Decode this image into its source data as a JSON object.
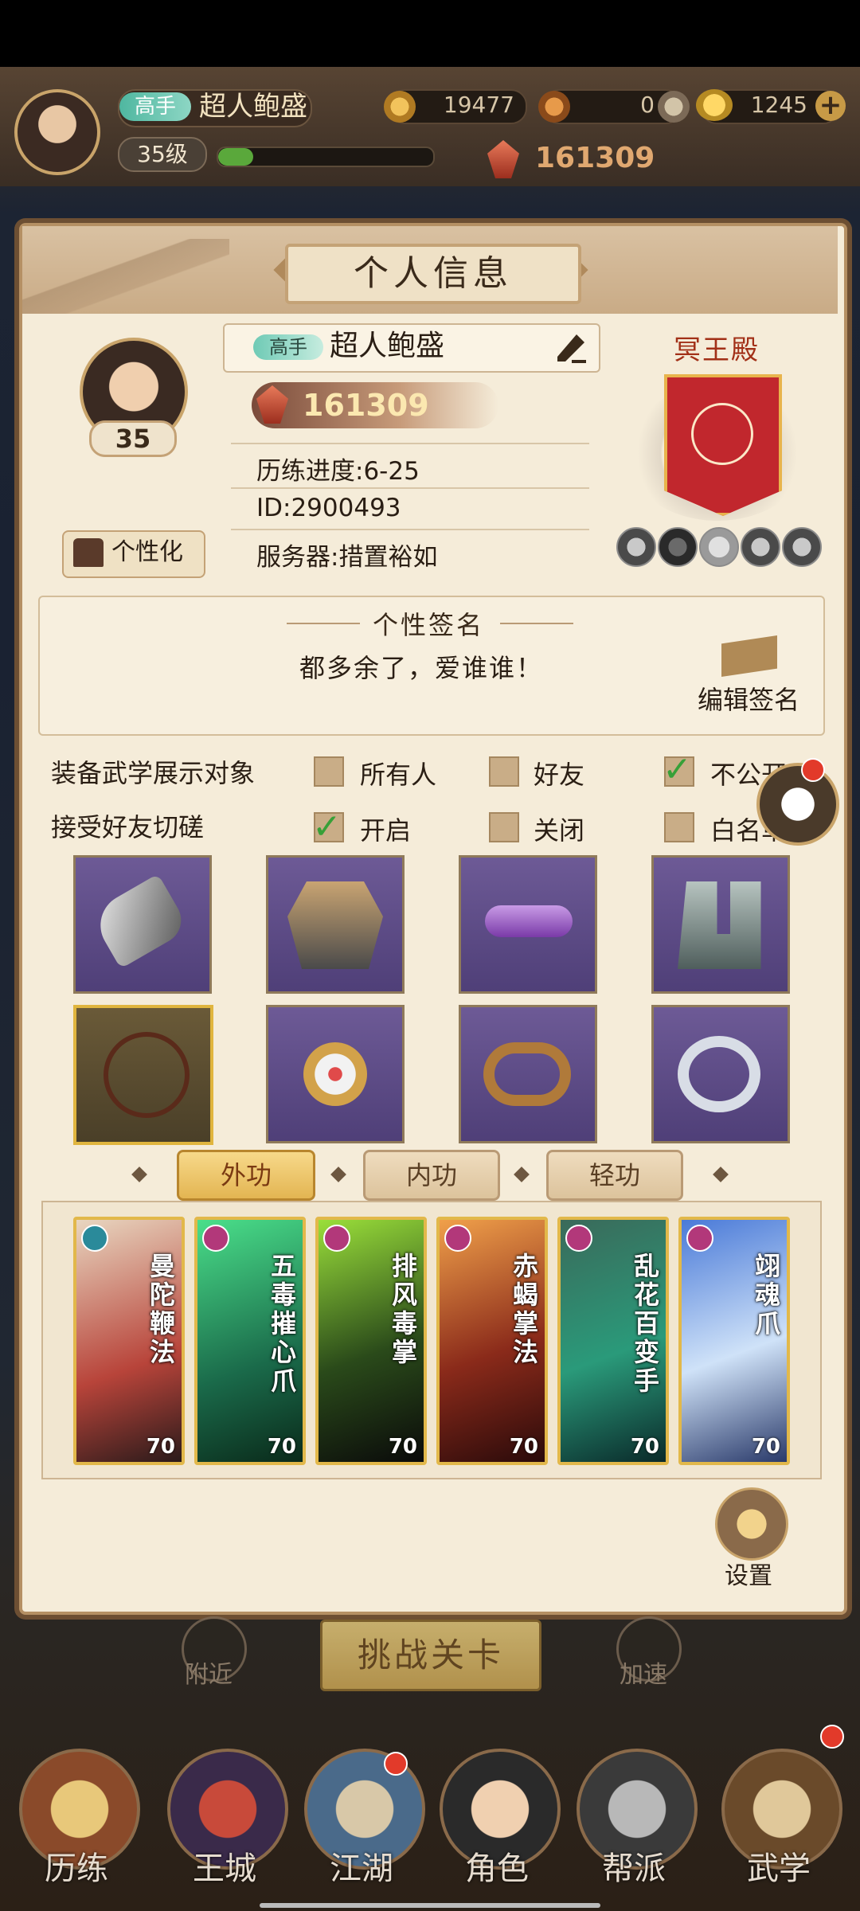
{
  "hud": {
    "rank": "高手",
    "name": "超人鲍盛",
    "level": "35级",
    "xp_fraction": 0.15,
    "coins": "19477",
    "second_currency": "0",
    "gold": "1245",
    "power": "161309"
  },
  "panel": {
    "title": "个人信息",
    "avatar_level": "35",
    "rank_tag": "高手",
    "name": "超人鲍盛",
    "power": "161309",
    "progress": "历练进度:6-25",
    "id": "ID:2900493",
    "server": "服务器:措置裕如",
    "customize_label": "个性化",
    "guild_name": "冥王殿",
    "badges": [
      "badge-1",
      "badge-2",
      "badge-3",
      "badge-4",
      "badge-5",
      "badge-6"
    ]
  },
  "signature": {
    "title": "个性签名",
    "text": "都多余了，爱谁谁！",
    "edit_label": "编辑签名"
  },
  "settings_rows": {
    "row1": {
      "label": "装备武学展示对象",
      "options": [
        {
          "text": "所有人",
          "checked": false
        },
        {
          "text": "好友",
          "checked": false
        },
        {
          "text": "不公开",
          "checked": true
        }
      ]
    },
    "row2": {
      "label": "接受好友切磋",
      "options": [
        {
          "text": "开启",
          "checked": true
        },
        {
          "text": "关闭",
          "checked": false
        },
        {
          "text": "白名单",
          "checked": false
        }
      ]
    }
  },
  "equipment": [
    "weapon",
    "armor",
    "belt",
    "boots",
    "necklace",
    "hairpin",
    "bracelet",
    "ring"
  ],
  "tabs": {
    "outer": "外功",
    "inner": "内功",
    "light": "轻功",
    "active": "外功"
  },
  "skills": [
    {
      "name": "曼陀鞭法",
      "level": "70"
    },
    {
      "name": "五毒摧心爪",
      "level": "70"
    },
    {
      "name": "排风毒掌",
      "level": "70"
    },
    {
      "name": "赤蝎掌法",
      "level": "70"
    },
    {
      "name": "乱花百变手",
      "level": "70"
    },
    {
      "name": "翊魂爪",
      "level": "70"
    }
  ],
  "settings_label": "设置",
  "challenge_label": "挑战关卡",
  "side_left": "附近",
  "side_right": "加速",
  "nav": {
    "lilian": "历练",
    "wangcheng": "王城",
    "jianghu": "江湖",
    "juese": "角色",
    "bangpai": "帮派",
    "wuxue": "武学"
  },
  "colors": {
    "panel_bg": "#f5ecd9",
    "accent_gold": "#e2b84a",
    "banner_red": "#c1272d",
    "check_green": "#37a038"
  }
}
